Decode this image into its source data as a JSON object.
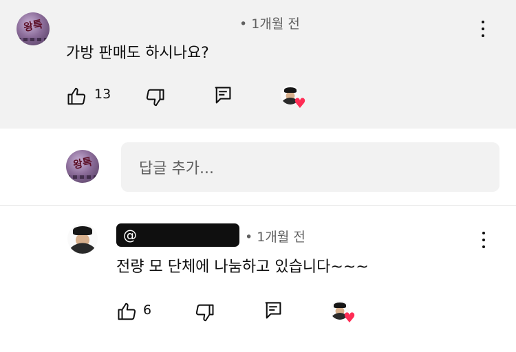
{
  "comment": {
    "timestamp": "• 1개월 전",
    "text": "가방 판매도 하시나요?",
    "like_count": "13",
    "avatar_text": "왕특"
  },
  "reply_box": {
    "placeholder": "답글 추가..."
  },
  "reply": {
    "handle": "@",
    "timestamp": "• 1개월 전",
    "text": "전량 모 단체에 나눔하고 있습니다~~~",
    "like_count": "6"
  },
  "colors": {
    "comment_bg": "#f2f2f2",
    "heart": "#ff2d55",
    "muted_text": "#606060"
  },
  "icons": [
    "like-icon",
    "dislike-icon",
    "reply-icon",
    "more-vert-icon",
    "heart-icon"
  ]
}
